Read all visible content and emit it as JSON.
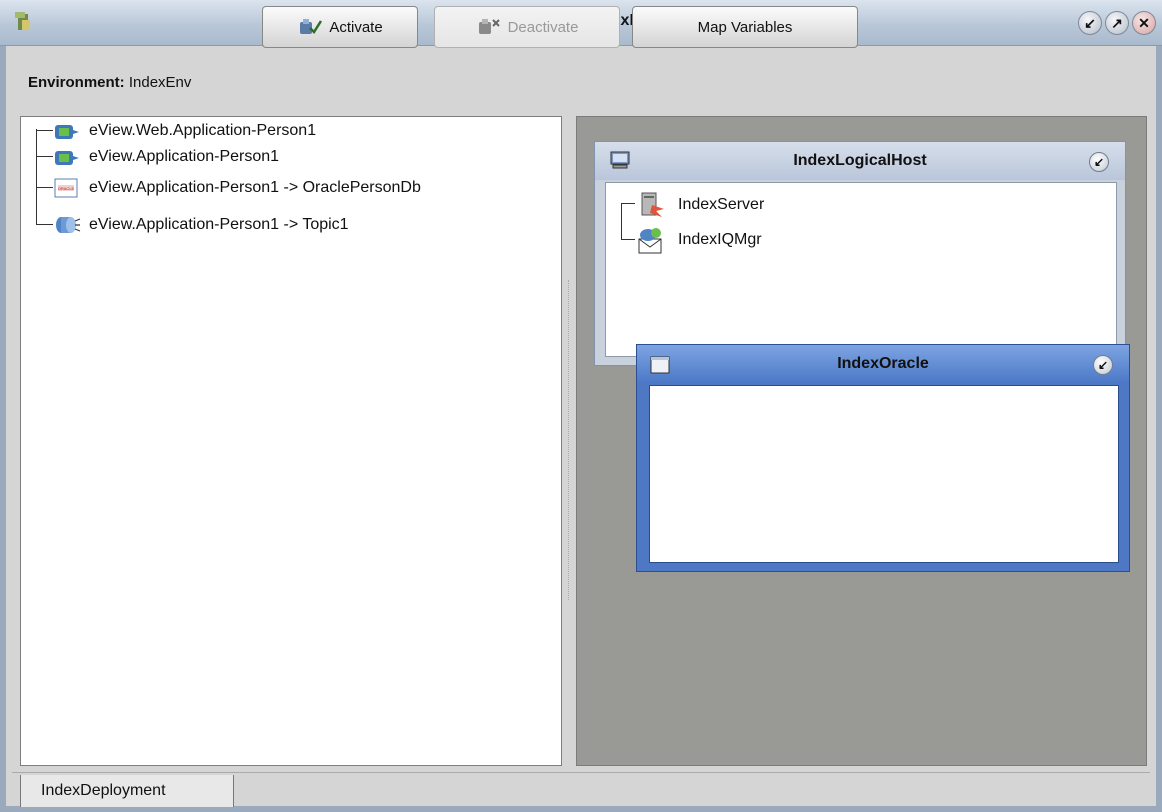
{
  "window": {
    "title": "Deployment Editor [IndexDeployment]",
    "controls": [
      "minimize-icon",
      "maximize-icon",
      "close-icon"
    ]
  },
  "toolbar": {
    "environment_label": "Environment:",
    "environment_value": "IndexEnv",
    "activate_label": "Activate",
    "deactivate_label": "Deactivate",
    "map_variables_label": "Map Variables"
  },
  "tree": {
    "items": [
      {
        "label": "eView.Web.Application-Person1",
        "icon": "application-icon"
      },
      {
        "label": "eView.Application-Person1",
        "icon": "application-icon"
      },
      {
        "label": "eView.Application-Person1 -> OraclePersonDb",
        "icon": "oracle-icon"
      },
      {
        "label": "eView.Application-Person1 -> Topic1",
        "icon": "topic-icon"
      }
    ]
  },
  "logical_host": {
    "title": "IndexLogicalHost",
    "items": [
      {
        "label": "IndexServer",
        "icon": "server-icon"
      },
      {
        "label": "IndexIQMgr",
        "icon": "queue-manager-icon"
      }
    ]
  },
  "oracle_host": {
    "title": "IndexOracle"
  },
  "bottom_tabs": {
    "active": "IndexDeployment"
  },
  "colors": {
    "title_bar": "#b9c8d8",
    "canvas": "#999a95",
    "oracle_frame": "#4f78c4"
  }
}
